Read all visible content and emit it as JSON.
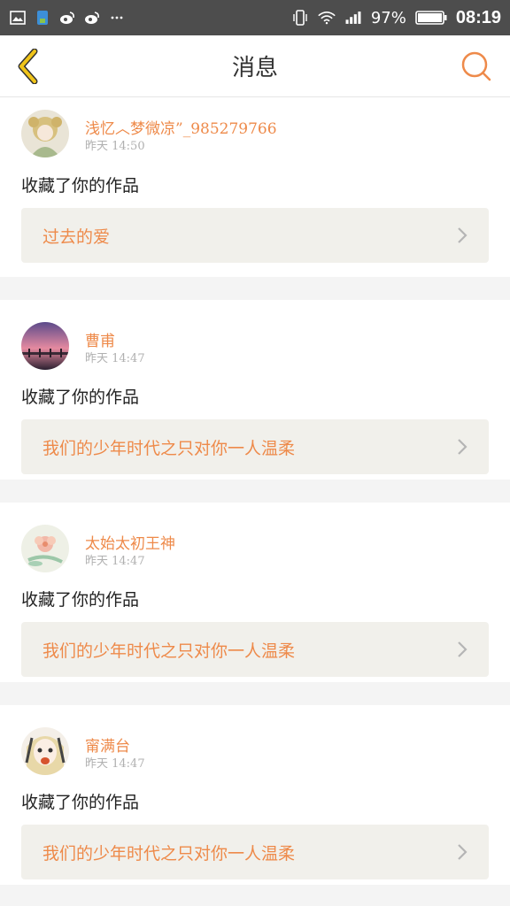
{
  "status_bar": {
    "battery_percent": "97%",
    "time": "08:19",
    "icons": [
      "gallery-icon",
      "browser-icon",
      "weibo-icon",
      "weibo-icon",
      "more-dots-icon",
      "vibrate-icon",
      "wifi-icon",
      "signal-icon",
      "battery-icon"
    ]
  },
  "nav": {
    "title": "消息"
  },
  "messages": [
    {
      "username": "浅忆︿梦微凉”_985279766",
      "time": "昨天 14:50",
      "action": "收藏了你的作品",
      "work_title": "过去的爱"
    },
    {
      "username": "曹甫",
      "time": "昨天 14:47",
      "action": "收藏了你的作品",
      "work_title": "我们的少年时代之只对你一人温柔"
    },
    {
      "username": "太始太初王神",
      "time": "昨天 14:47",
      "action": "收藏了你的作品",
      "work_title": "我们的少年时代之只对你一人温柔"
    },
    {
      "username": "甯满台",
      "time": "昨天 14:47",
      "action": "收藏了你的作品",
      "work_title": "我们的少年时代之只对你一人温柔"
    }
  ],
  "colors": {
    "accent": "#ee8a4a",
    "status_bar": "#4d4d4d",
    "back_icon": "#f0c419",
    "work_box": "#f1f0eb"
  }
}
